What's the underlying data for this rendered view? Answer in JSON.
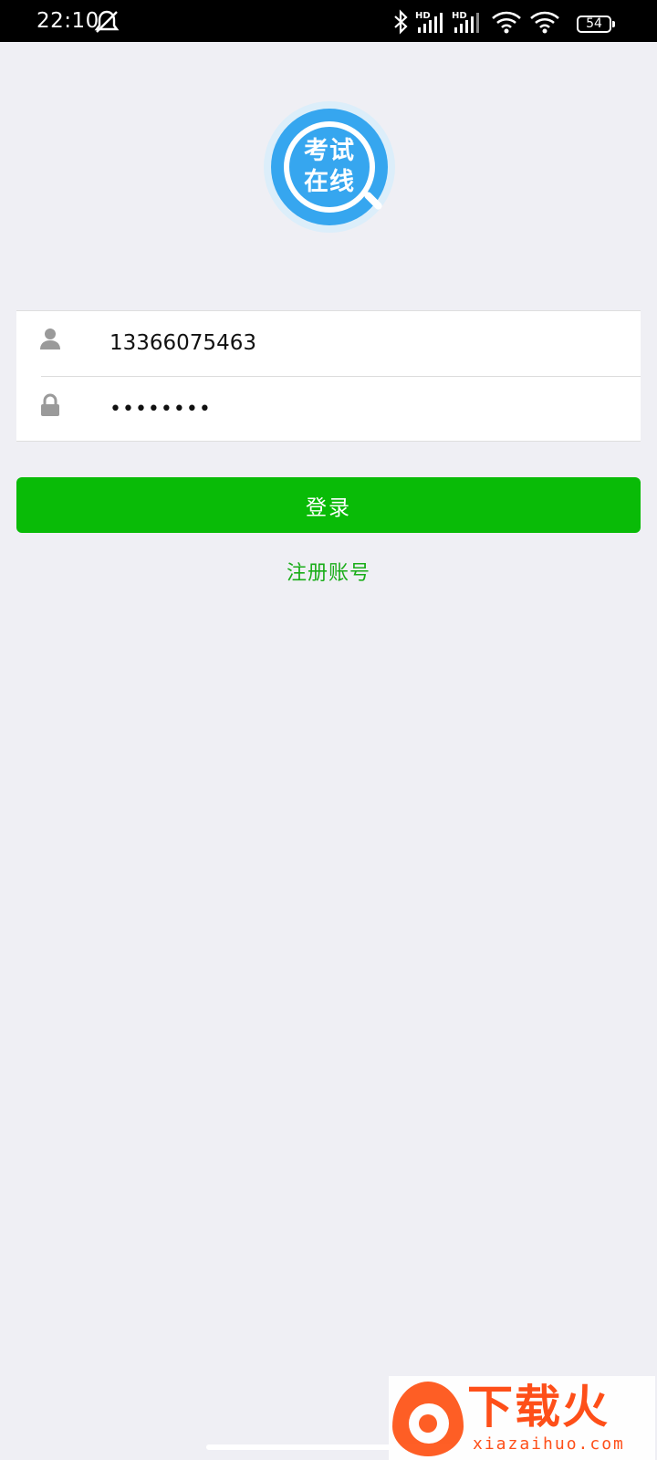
{
  "status_bar": {
    "time": "22:10",
    "icons": [
      "mute-icon",
      "bluetooth-icon",
      "signal-hd-icon",
      "signal-hd-icon",
      "wifi-icon",
      "wifi-icon"
    ],
    "battery": "54"
  },
  "logo": {
    "line1": "考试",
    "line2": "在线",
    "brand_color": "#36a6ef"
  },
  "form": {
    "username_value": "13366075463",
    "password_value": "••••••••"
  },
  "actions": {
    "login_label": "登录",
    "register_label": "注册账号",
    "accent_color": "#09bb07"
  },
  "watermark": {
    "title": "下载火",
    "url": "xiazaihuo.com"
  }
}
